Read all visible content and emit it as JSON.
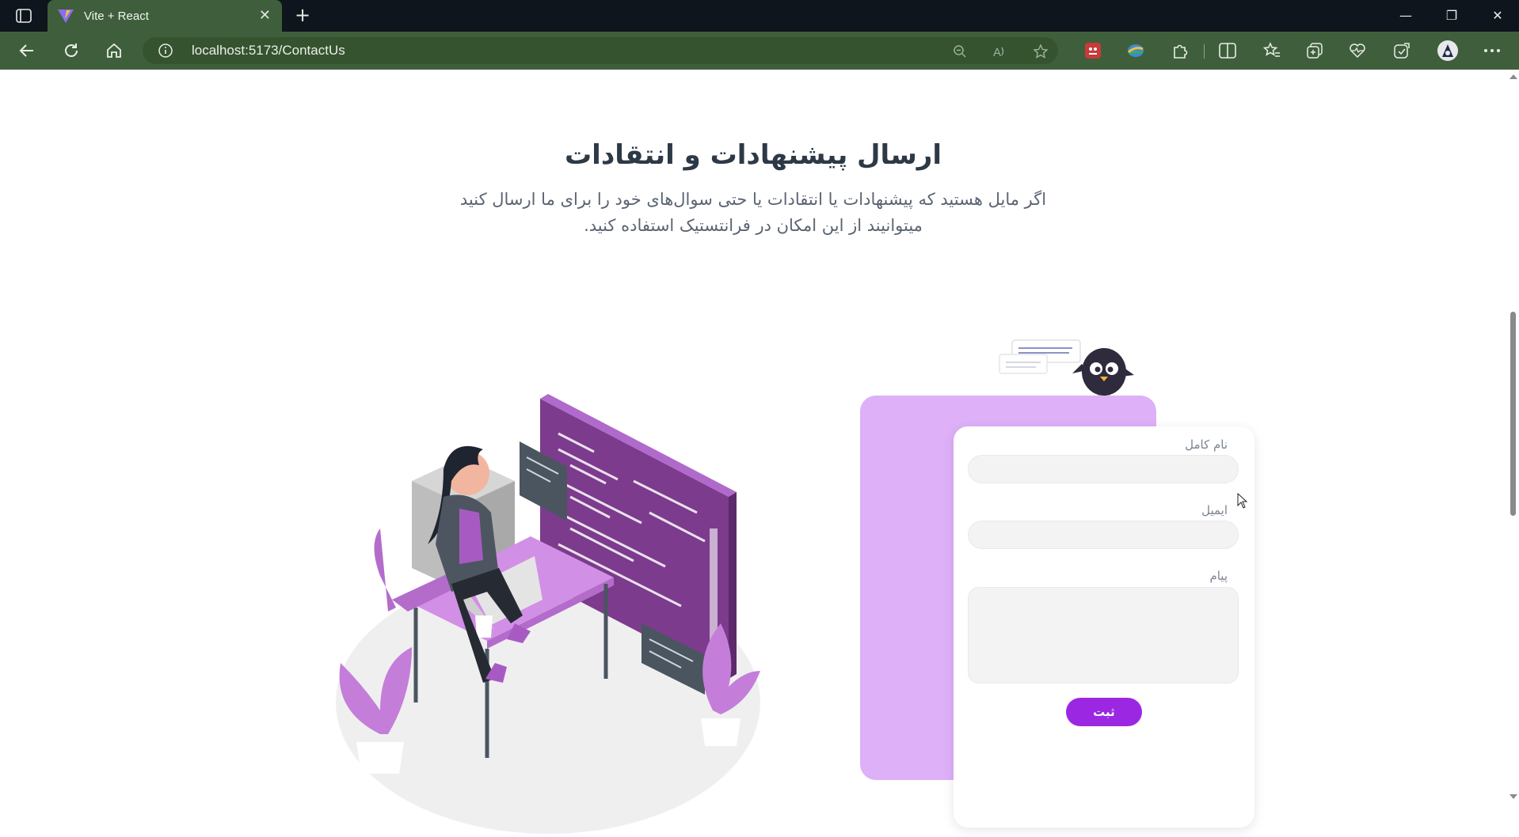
{
  "browser": {
    "tab_title": "Vite + React",
    "url": "localhost:5173/ContactUs",
    "icons": [
      "tab-actions-icon",
      "vite-favicon-icon",
      "close-icon",
      "plus-icon",
      "minimize-icon",
      "restore-icon",
      "close-window-icon",
      "back-arrow-icon",
      "reload-icon",
      "home-icon",
      "info-icon",
      "zoom-out-icon",
      "read-aloud-icon",
      "star-icon",
      "extension-red-icon",
      "extension-globe-icon",
      "puzzle-icon",
      "split-screen-icon",
      "favorites-icon",
      "collections-icon",
      "health-icon",
      "copilot-icon",
      "avatar-icon",
      "more-icon"
    ]
  },
  "page": {
    "heading": "ارسال پیشنهادات و انتقادات",
    "subtitle": "اگر مایل هستید که پیشنهادات یا انتقادات یا حتی سوال‌های خود را برای ما ارسال کنید میتوانیند از این امکان در فرانتستیک استفاده کنید.",
    "form": {
      "name_label": "نام کامل",
      "name_value": "",
      "email_label": "ایمیل",
      "email_value": "",
      "message_label": "پیام",
      "message_value": "",
      "submit_label": "ثبت"
    },
    "colors": {
      "accent": "#9b27e3",
      "card_purple": "#deb0f8",
      "tab_green": "#3f5f3c"
    }
  }
}
